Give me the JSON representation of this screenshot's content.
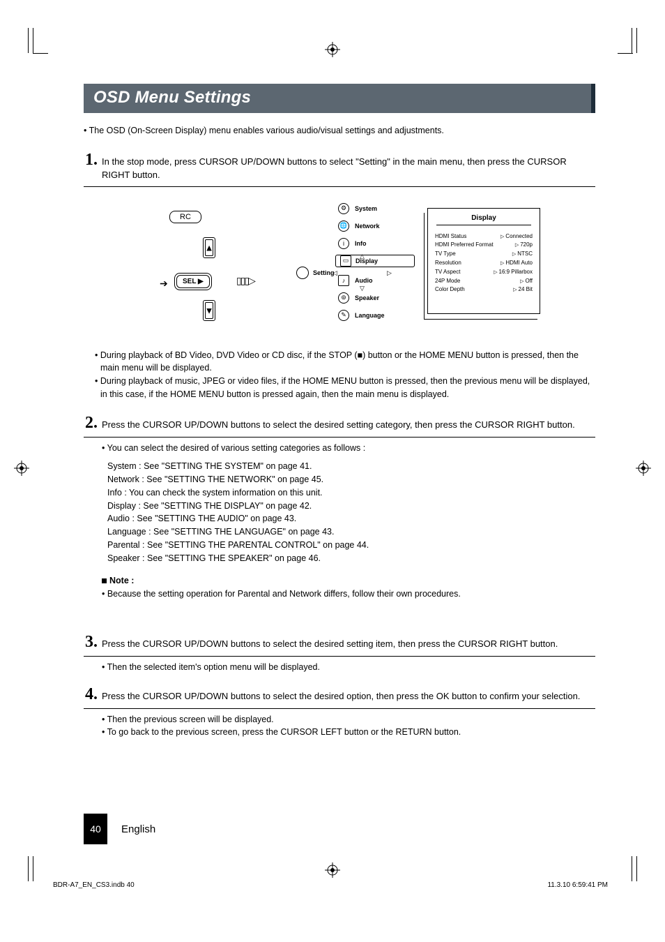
{
  "title": "OSD Menu Settings",
  "intro_bullet": "• The OSD (On-Screen Display) menu enables various audio/visual settings and adjustments.",
  "step1": {
    "num": "1.",
    "text": "In the stop mode, press CURSOR UP/DOWN buttons to select \"Setting\" in the main menu, then press the CURSOR RIGHT button."
  },
  "figure": {
    "rc_label": "RC",
    "sel_label": "SEL  ▶",
    "setting_label": "Setting",
    "menu": {
      "system": "System",
      "network": "Network",
      "info": "Info",
      "display": "Display",
      "audio": "Audio",
      "speaker": "Speaker",
      "language": "Language"
    },
    "panel": {
      "title": "Display",
      "rows": [
        {
          "k": "HDMI Status",
          "v": "Connected"
        },
        {
          "k": "HDMI Preferred Format",
          "v": "720p"
        },
        {
          "k": "TV Type",
          "v": "NTSC"
        },
        {
          "k": "Resolution",
          "v": "HDMI Auto"
        },
        {
          "k": "TV Aspect",
          "v": "16:9 Pillarbox"
        },
        {
          "k": "24P Mode",
          "v": "Off"
        },
        {
          "k": "Color Depth",
          "v": "24 Bit"
        }
      ]
    }
  },
  "post_fig": {
    "a": "• During playback of BD Video, DVD Video or CD disc, if the STOP (■) button or the HOME MENU button is pressed, then the main menu will be displayed.",
    "b": "• During playback of music, JPEG or video files, if the HOME MENU button is pressed, then the previous menu will be displayed, in this case, if the HOME MENU button is pressed again, then the main menu is displayed."
  },
  "step2": {
    "num": "2.",
    "text": "Press the CURSOR UP/DOWN buttons to select the desired setting category, then press the CURSOR RIGHT button.",
    "sub_bullet": "• You can  select the desired of various setting categories as follows :",
    "refs": {
      "system": "System : See \"SETTING THE SYSTEM\" on page 41.",
      "network": "Network : See \"SETTING THE NETWORK\" on page 45.",
      "info": "Info : You can check the system information on this unit.",
      "display": "Display : See \"SETTING THE DISPLAY\" on page 42.",
      "audio": "Audio : See \"SETTING THE AUDIO\" on page 43.",
      "language": "Language : See \"SETTING THE LANGUAGE\" on page 43.",
      "parental": "Parental : See \"SETTING THE PARENTAL CONTROL\" on page 44.",
      "speaker": "Speaker : See \"SETTING THE SPEAKER\" on page 46."
    },
    "note_label": "Note :",
    "note_text": "• Because the setting operation for Parental and Network differs, follow their own procedures."
  },
  "step3": {
    "num": "3.",
    "text": "Press the CURSOR UP/DOWN buttons to select the desired setting item, then press the CURSOR RIGHT button.",
    "sub": "• Then the selected item's option menu will be displayed."
  },
  "step4": {
    "num": "4.",
    "text": "Press the CURSOR UP/DOWN buttons to select the desired option, then press the OK button to confirm your selection.",
    "sub_a": "• Then the previous screen will be displayed.",
    "sub_b": "• To go back to the previous screen, press the CURSOR LEFT button or the RETURN button."
  },
  "footer": {
    "page_num": "40",
    "lang": "English",
    "file": "BDR-A7_EN_CS3.indb   40",
    "date": "11.3.10   6:59:41 PM"
  }
}
